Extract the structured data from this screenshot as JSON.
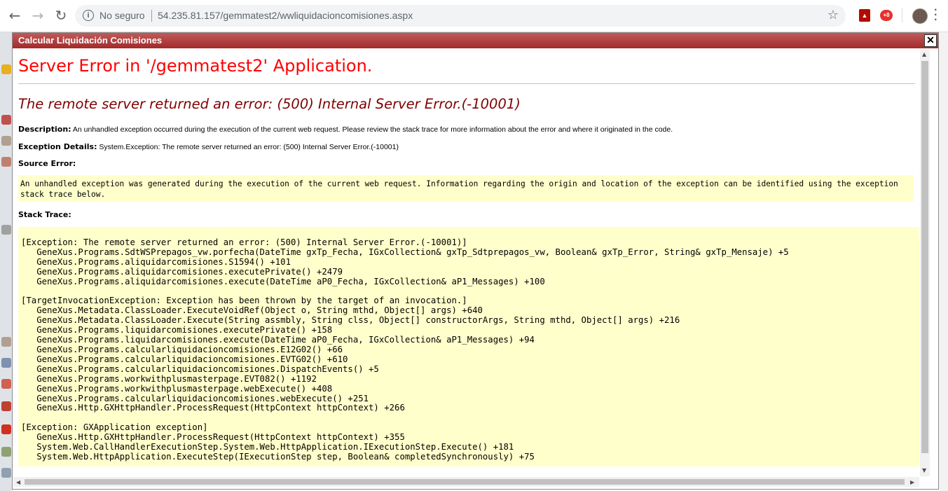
{
  "browser": {
    "security_label": "No seguro",
    "url": "54.235.81.157/gemmatest2/wwliquidacioncomisiones.aspx",
    "back_icon": "arrow-left-icon",
    "forward_icon": "arrow-right-icon",
    "reload_icon": "reload-icon",
    "star_icon": "star-icon",
    "extension_badge": "+8"
  },
  "dialog": {
    "title": "Calcular Liquidación Comisiones",
    "close_glyph": "✕"
  },
  "error": {
    "heading": "Server Error in '/gemmatest2' Application.",
    "message": "The remote server returned an error: (500) Internal Server Error.(-10001)",
    "description_label": "Description:",
    "description_text": " An unhandled exception occurred during the execution of the current web request. Please review the stack trace for more information about the error and where it originated in the code.",
    "exception_label": "Exception Details:",
    "exception_text": " System.Exception: The remote server returned an error: (500) Internal Server Error.(-10001)",
    "source_label": "Source Error:",
    "source_text": "An unhandled exception was generated during the execution of the current web request. Information regarding the origin and location of the exception can be identified using the exception stack trace below.",
    "stack_label": "Stack Trace:",
    "stack_trace": "[Exception: The remote server returned an error: (500) Internal Server Error.(-10001)]\n   GeneXus.Programs.SdtWSPrepagos_vw.porfecha(DateTime gxTp_Fecha, IGxCollection& gxTp_Sdtprepagos_vw, Boolean& gxTp_Error, String& gxTp_Mensaje) +5\n   GeneXus.Programs.aliquidarcomisiones.S1594() +101\n   GeneXus.Programs.aliquidarcomisiones.executePrivate() +2479\n   GeneXus.Programs.aliquidarcomisiones.execute(DateTime aP0_Fecha, IGxCollection& aP1_Messages) +100\n\n[TargetInvocationException: Exception has been thrown by the target of an invocation.]\n   GeneXus.Metadata.ClassLoader.ExecuteVoidRef(Object o, String mthd, Object[] args) +640\n   GeneXus.Metadata.ClassLoader.Execute(String assmbly, String clss, Object[] constructorArgs, String mthd, Object[] args) +216\n   GeneXus.Programs.liquidarcomisiones.executePrivate() +158\n   GeneXus.Programs.liquidarcomisiones.execute(DateTime aP0_Fecha, IGxCollection& aP1_Messages) +94\n   GeneXus.Programs.calcularliquidacioncomisiones.E12G02() +66\n   GeneXus.Programs.calcularliquidacioncomisiones.EVTG02() +610\n   GeneXus.Programs.calcularliquidacioncomisiones.DispatchEvents() +5\n   GeneXus.Programs.workwithplusmasterpage.EVT082() +1192\n   GeneXus.Programs.workwithplusmasterpage.webExecute() +408\n   GeneXus.Programs.calcularliquidacioncomisiones.webExecute() +251\n   GeneXus.Http.GXHttpHandler.ProcessRequest(HttpContext httpContext) +266\n\n[Exception: GXApplication exception]\n   GeneXus.Http.GXHttpHandler.ProcessRequest(HttpContext httpContext) +355\n   System.Web.CallHandlerExecutionStep.System.Web.HttpApplication.IExecutionStep.Execute() +181\n   System.Web.HttpApplication.ExecuteStep(IExecutionStep step, Boolean& completedSynchronously) +75"
  },
  "colors": {
    "heading": "#ff0000",
    "message": "#800000",
    "code_background": "#ffffcc",
    "dialog_header": "#a32a2a"
  }
}
